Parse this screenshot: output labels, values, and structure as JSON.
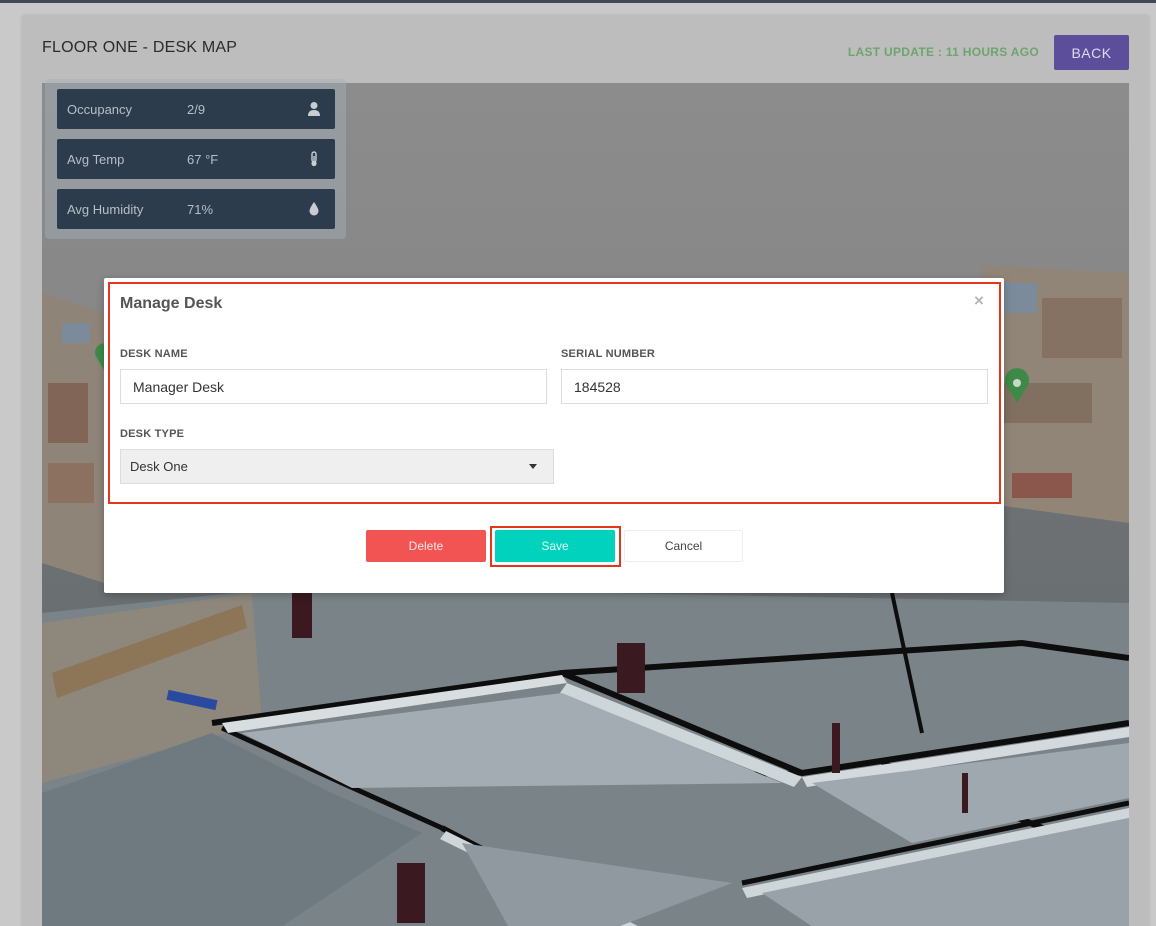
{
  "header": {
    "title": "FLOOR ONE - DESK MAP",
    "last_update": "LAST UPDATE : 11 HOURS AGO",
    "back_label": "BACK"
  },
  "stats": [
    {
      "label": "Occupancy",
      "value": "2/9",
      "icon": "person-icon"
    },
    {
      "label": "Avg Temp",
      "value": "67 °F",
      "icon": "thermometer-icon"
    },
    {
      "label": "Avg Humidity",
      "value": "71%",
      "icon": "droplet-icon"
    }
  ],
  "modal": {
    "title": "Manage Desk",
    "close_symbol": "×",
    "desk_name": {
      "label": "DESK NAME",
      "value": "Manager Desk"
    },
    "serial_number": {
      "label": "SERIAL NUMBER",
      "value": "184528"
    },
    "desk_type": {
      "label": "DESK TYPE",
      "selected": "Desk One"
    },
    "buttons": {
      "delete": "Delete",
      "save": "Save",
      "cancel": "Cancel"
    }
  },
  "colors": {
    "accent_purple": "#5d4e9c",
    "last_update_green": "#6da56d",
    "stat_bg": "#2c3c4d",
    "delete_red": "#f25454",
    "save_teal": "#00d2be",
    "highlight_red": "#e2361d"
  }
}
